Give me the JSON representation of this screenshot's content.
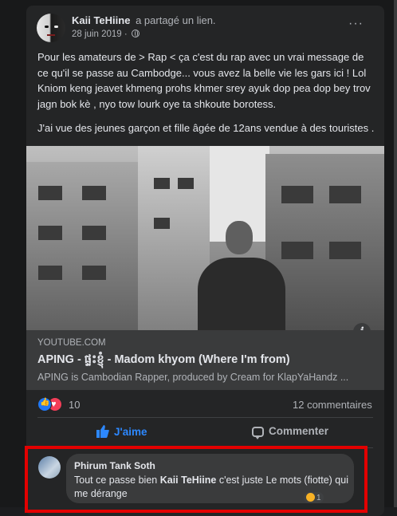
{
  "post": {
    "author": "Kaii TeHiine",
    "action": "a partagé un lien.",
    "date": "28 juin 2019 ·",
    "more_label": "···",
    "paragraphs": [
      "Pour les amateurs de > Rap < ça c'est du rap avec un vrai message de ce qu'il se passe au Cambodge... vous avez la belle vie les gars ici ! Lol Kniom keng jeavet khmeng prohs khmer srey ayuk dop pea dop bey trov jagn bok kè , nyo tow lourk oye ta shkoute borotess.",
      "J'ai vue des jeunes garçon et fille âgée de 12ans vendue à des touristes ."
    ]
  },
  "link": {
    "domain": "YOUTUBE.COM",
    "title": "APING - ផ្ទះខ្ញុំ - Madom khyom (Where I'm from)",
    "description": "APING is Cambodian Rapper, produced by Cream for KlapYaHandz ...",
    "info_label": "i"
  },
  "stats": {
    "reactions_count": "10",
    "comments_count": "12 commentaires"
  },
  "actions": {
    "like_label": "J'aime",
    "comment_label": "Commenter"
  },
  "comment": {
    "author": "Phirum Tank Soth",
    "text_before": "Tout ce passe bien ",
    "mention": "Kaii TeHiine",
    "text_after": " c'est juste Le mots (fiotte) qui me dérange",
    "reaction_count": "1"
  },
  "colors": {
    "background": "#18191a",
    "card": "#242526",
    "accent_blue": "#2d88ff",
    "highlight_red": "#e30000"
  }
}
